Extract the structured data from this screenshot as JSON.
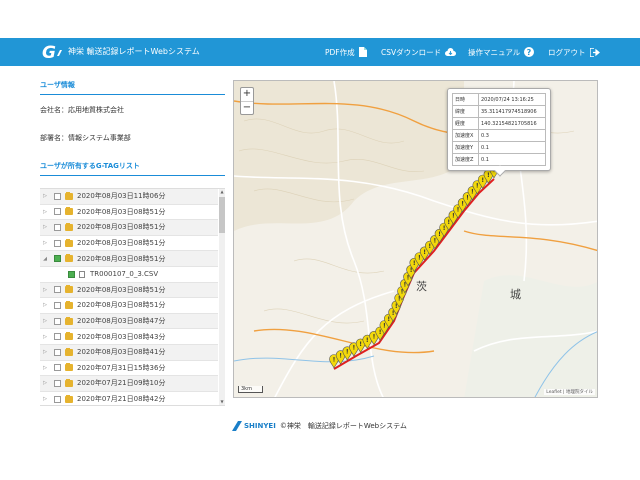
{
  "header": {
    "app_title": "神栄 輸送記録レポートWebシステム",
    "nav": [
      {
        "label": "PDF作成"
      },
      {
        "label": "CSVダウンロード"
      },
      {
        "label": "操作マニュアル"
      },
      {
        "label": "ログアウト"
      }
    ],
    "colors": {
      "bar": "#2196d6",
      "accent": "#1a8cd8"
    }
  },
  "user_info": {
    "title": "ユーザ情報",
    "company": "会社名：応用地質株式会社",
    "department": "部署名：情報システム事業部"
  },
  "tag_list": {
    "title": "ユーザが所有するG-TAGリスト",
    "items": [
      {
        "label": "2020年08月03日11時06分"
      },
      {
        "label": "2020年08月03日08時51分"
      },
      {
        "label": "2020年08月03日08時51分"
      },
      {
        "label": "2020年08月03日08時51分"
      },
      {
        "label": "2020年08月03日08時51分",
        "expanded": true
      },
      {
        "label": "TR000107_0_3.CSV",
        "child": true
      },
      {
        "label": "2020年08月03日08時51分"
      },
      {
        "label": "2020年08月03日08時51分"
      },
      {
        "label": "2020年08月03日08時47分"
      },
      {
        "label": "2020年08月03日08時43分"
      },
      {
        "label": "2020年08月03日08時41分"
      },
      {
        "label": "2020年07月31日15時36分"
      },
      {
        "label": "2020年07月21日09時10分"
      },
      {
        "label": "2020年07月21日08時42分"
      },
      {
        "label": "2020年07月21日08時45分"
      }
    ]
  },
  "map": {
    "zoom_in": "+",
    "zoom_out": "−",
    "scale": "3km",
    "attribution": "Leaflet | 地理院タイル",
    "labels": [
      {
        "text": "茨"
      },
      {
        "text": "城"
      }
    ],
    "popup": {
      "rows": [
        {
          "key": "日時",
          "value": "2020/07/24 13:16:25"
        },
        {
          "key": "緯度",
          "value": "35.311417974518906"
        },
        {
          "key": "経度",
          "value": "140.32154821705816"
        },
        {
          "key": "加速度X",
          "value": "0.3"
        },
        {
          "key": "加速度Y",
          "value": "0.1"
        },
        {
          "key": "加速度Z",
          "value": "0.1"
        }
      ]
    },
    "marker_color": "#f2d80b",
    "route_color": "#e02020"
  },
  "footer": {
    "brand": "SHINYEI",
    "text": "©神栄　輸送記録レポートWebシステム"
  }
}
